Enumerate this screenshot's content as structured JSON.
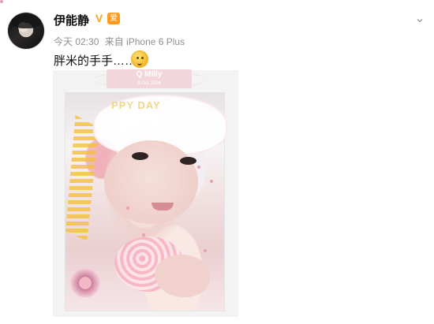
{
  "post": {
    "author": "伊能静",
    "time": "今天 02:30",
    "source": "来自 iPhone 6 Plus",
    "text": "胖米的手手………"
  },
  "badges": {
    "verified": "V",
    "fan": "爱"
  },
  "image_overlay": {
    "name": "Q Milly",
    "date": "9 Oct 2016",
    "decorative_text": "PPY DAY"
  },
  "icons": {
    "avatar": "avatar",
    "chevron": "chevron-down-icon",
    "emoji": "thinking-face-emoji",
    "verified": "verified-icon",
    "fan": "fan-badge-icon"
  },
  "colors": {
    "background": "#ffffff",
    "text": "#111111",
    "meta": "#8f8f8f",
    "verified": "#f6a623",
    "fan_badge": "#ff9a1f"
  }
}
